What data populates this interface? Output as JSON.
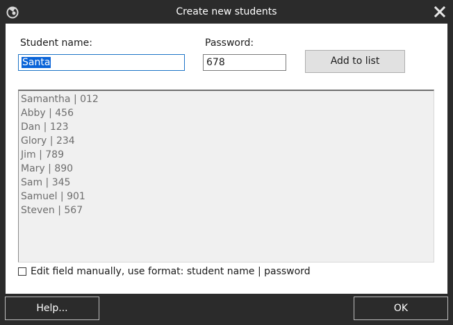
{
  "window": {
    "title": "Create new students"
  },
  "form": {
    "name_label": "Student name:",
    "name_value": "Santa",
    "password_label": "Password:",
    "password_value": "678",
    "add_label": "Add to list"
  },
  "students": [
    "Samantha | 012",
    "Abby | 456",
    "Dan | 123",
    "Glory | 234",
    "Jim | 789",
    "Mary | 890",
    "Sam | 345",
    "Samuel | 901",
    "Steven | 567"
  ],
  "manual_edit": {
    "label": "Edit field manually, use format: student name | password",
    "checked": false
  },
  "footer": {
    "help_label": "Help...",
    "ok_label": "OK"
  },
  "icons": {
    "app": "app-logo-icon",
    "close": "close-icon"
  },
  "colors": {
    "chrome": "#2b2b2b",
    "selection": "#0a64d8",
    "focus_border": "#1c73c7"
  }
}
